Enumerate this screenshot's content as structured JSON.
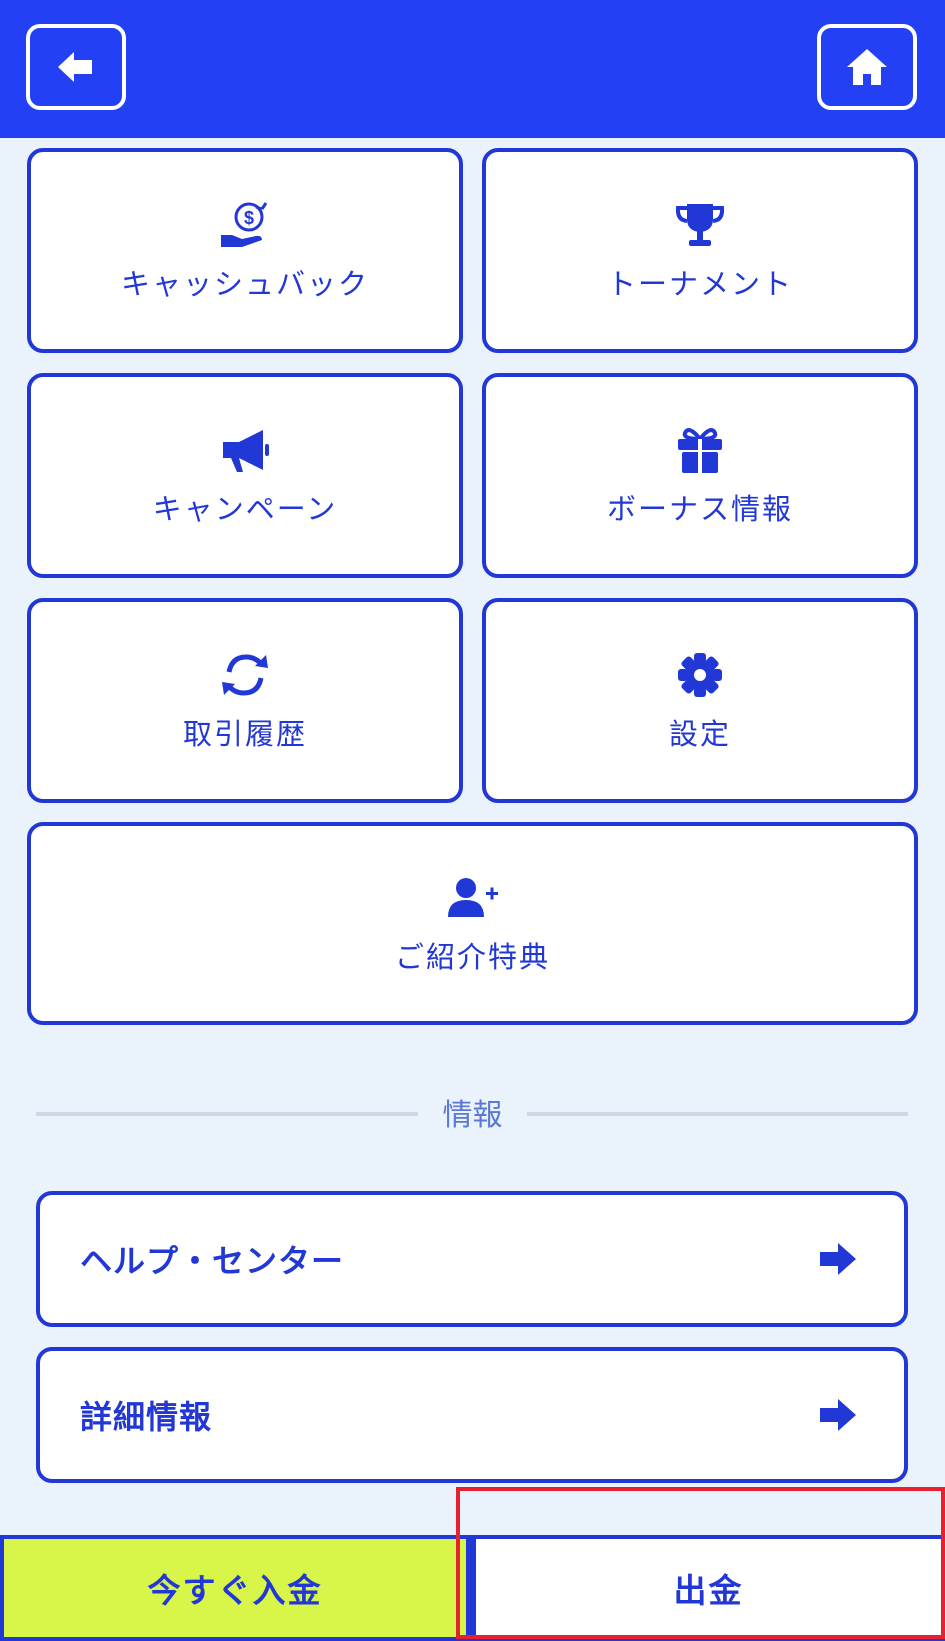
{
  "header": {
    "back_icon": "back-arrow-icon",
    "home_icon": "home-icon"
  },
  "tiles": [
    {
      "label": "キャッシュバック",
      "icon": "cashback-icon"
    },
    {
      "label": "トーナメント",
      "icon": "trophy-icon"
    },
    {
      "label": "キャンペーン",
      "icon": "megaphone-icon"
    },
    {
      "label": "ボーナス情報",
      "icon": "gift-icon"
    },
    {
      "label": "取引履歴",
      "icon": "refresh-icon"
    },
    {
      "label": "設定",
      "icon": "gear-icon"
    },
    {
      "label": "ご紹介特典",
      "icon": "add-user-icon"
    }
  ],
  "info_section": {
    "title": "情報",
    "items": [
      {
        "label": "ヘルプ・センター",
        "icon": "arrow-right-icon"
      },
      {
        "label": "詳細情報",
        "icon": "arrow-right-icon"
      }
    ]
  },
  "bottom_bar": {
    "deposit_label": "今すぐ入金",
    "withdraw_label": "出金"
  },
  "colors": {
    "accent": "#2238d6",
    "header_bg": "#2340f5",
    "page_bg": "#eaf2fc",
    "deposit_bg": "#d8f54a",
    "highlight": "#e5202f"
  }
}
